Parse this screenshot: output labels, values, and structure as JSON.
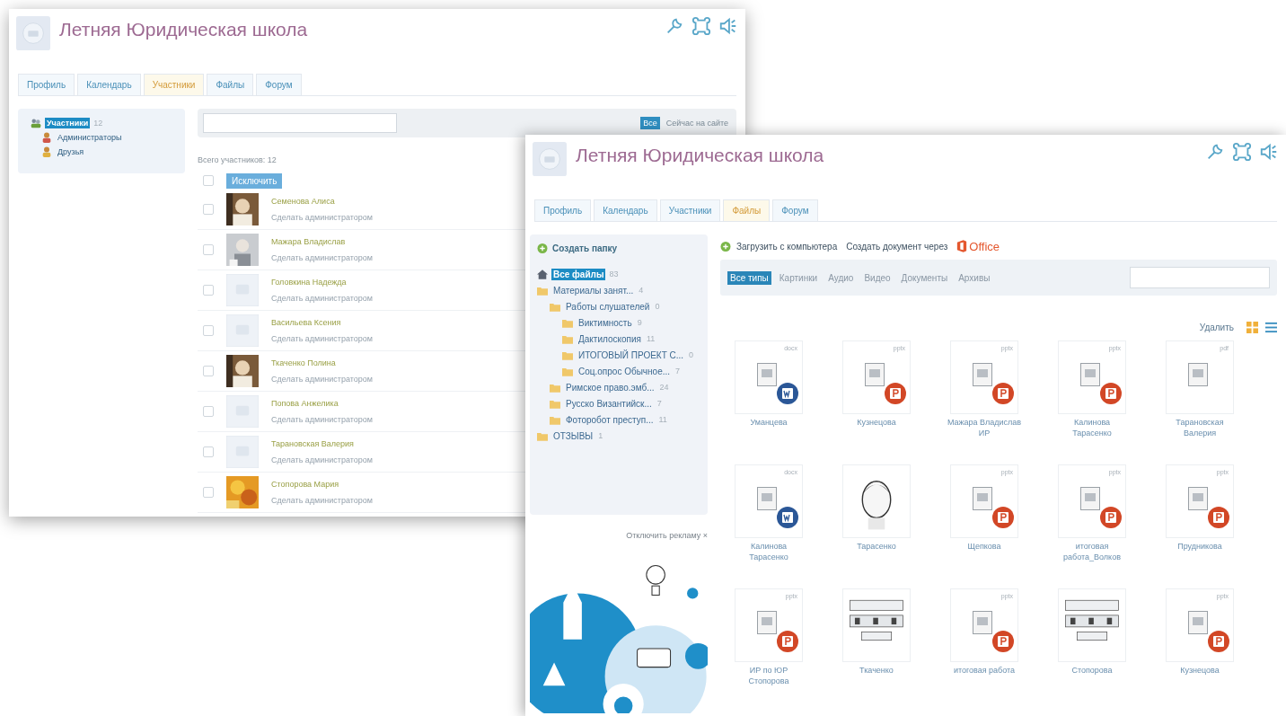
{
  "members_window": {
    "title": "Летняя Юридическая школа",
    "tabs": [
      {
        "label": "Профиль",
        "selected": false
      },
      {
        "label": "Календарь",
        "selected": false
      },
      {
        "label": "Участники",
        "selected": true
      },
      {
        "label": "Файлы",
        "selected": false
      },
      {
        "label": "Форум",
        "selected": false
      }
    ],
    "groups": [
      {
        "label": "Участники",
        "count": "12",
        "selected": true,
        "kind": "group",
        "children": [
          {
            "label": "Администраторы",
            "selected": false,
            "kind": "admin"
          },
          {
            "label": "Друзья",
            "selected": false,
            "kind": "friend"
          }
        ]
      }
    ],
    "filters": [
      {
        "label": "Все",
        "selected": true
      },
      {
        "label": "Сейчас на сайте",
        "selected": false
      }
    ],
    "total": "Всего участников: 12",
    "select_all_checked": false,
    "exclude_button": "Исключить",
    "members": [
      {
        "name": "Семенова Алиса",
        "action": "Сделать администратором",
        "checked": false
      },
      {
        "name": "Мажара Владислав",
        "action": "Сделать администратором",
        "checked": false
      },
      {
        "name": "Головкина Надежда",
        "action": "Сделать администратором",
        "kind": "placeholder",
        "checked": false
      },
      {
        "name": "Васильева Ксения",
        "action": "Сделать администратором",
        "kind": "placeholder",
        "checked": false
      },
      {
        "name": "Ткаченко Полина",
        "action": "Сделать администратором",
        "checked": false
      },
      {
        "name": "Попова Анжелика",
        "action": "Сделать администратором",
        "kind": "placeholder",
        "checked": false
      },
      {
        "name": "Тарановская Валерия",
        "action": "Сделать администратором",
        "kind": "placeholder",
        "checked": false
      },
      {
        "name": "Стопорова Мария",
        "action": "Сделать администратором",
        "checked": false
      }
    ]
  },
  "files_window": {
    "title": "Летняя Юридическая школа",
    "tabs": [
      {
        "label": "Профиль",
        "selected": false
      },
      {
        "label": "Календарь",
        "selected": false
      },
      {
        "label": "Участники",
        "selected": false
      },
      {
        "label": "Файлы",
        "selected": true
      },
      {
        "label": "Форум",
        "selected": false
      }
    ],
    "create_folder": "Создать папку",
    "tree": [
      {
        "label": "Все файлы",
        "count": "83",
        "selected": true,
        "kind": "all"
      },
      {
        "label": "Материалы занят...",
        "count": "4",
        "selected": false,
        "kind": "folder",
        "children": [
          {
            "label": "Работы слушателей",
            "count": "0",
            "selected": false,
            "kind": "folder",
            "children": [
              {
                "label": "Виктимность",
                "count": "9",
                "selected": false,
                "kind": "folder"
              },
              {
                "label": "Дактилоскопия",
                "count": "11",
                "selected": false,
                "kind": "folder"
              },
              {
                "label": "ИТОГОВЫЙ ПРОЕКТ С...",
                "count": "0",
                "selected": false,
                "kind": "folder"
              },
              {
                "label": "Соц.опрос Обычное...",
                "count": "7",
                "selected": false,
                "kind": "folder"
              }
            ]
          },
          {
            "label": "Римское право.эмб...",
            "count": "24",
            "selected": false,
            "kind": "folder"
          },
          {
            "label": "Русско Византийск...",
            "count": "7",
            "selected": false,
            "kind": "folder"
          },
          {
            "label": "Фоторобот преступ...",
            "count": "11",
            "selected": false,
            "kind": "folder"
          }
        ]
      },
      {
        "label": "ОТЗЫВЫ",
        "count": "1",
        "selected": false,
        "kind": "folder"
      }
    ],
    "upload_link": "Загрузить с компьютера",
    "create_doc_link": "Создать документ через",
    "office_label": "Office",
    "type_filters": [
      {
        "label": "Все типы",
        "selected": true
      },
      {
        "label": "Картинки",
        "selected": false
      },
      {
        "label": "Аудио",
        "selected": false
      },
      {
        "label": "Видео",
        "selected": false
      },
      {
        "label": "Документы",
        "selected": false
      },
      {
        "label": "Архивы",
        "selected": false
      }
    ],
    "delete_link": "Удалить",
    "view_modes": [
      {
        "kind": "grid",
        "selected": true
      },
      {
        "kind": "list",
        "selected": false
      }
    ],
    "files": [
      {
        "name": "Уманцева",
        "ext": "docx",
        "kind": "word"
      },
      {
        "name": "Кузнецова",
        "ext": "pptx",
        "kind": "powerpoint"
      },
      {
        "name": "Мажара Владислав ИР",
        "ext": "pptx",
        "kind": "powerpoint"
      },
      {
        "name": "Калинова Тарасенко",
        "ext": "pptx",
        "kind": "powerpoint"
      },
      {
        "name": "Тарановская Валерия",
        "ext": "pdf",
        "kind": "document"
      },
      {
        "name": "Калинова Тарасенко",
        "ext": "docx",
        "kind": "word"
      },
      {
        "name": "Тарасенко",
        "kind": "picture"
      },
      {
        "name": "Щепкова",
        "ext": "pptx",
        "kind": "powerpoint"
      },
      {
        "name": "итоговая работа_Волков",
        "ext": "pptx",
        "kind": "powerpoint"
      },
      {
        "name": "Прудникова",
        "ext": "pptx",
        "kind": "powerpoint"
      },
      {
        "name": "ИР по ЮР Стопорова",
        "ext": "pptx",
        "kind": "powerpoint"
      },
      {
        "name": "Ткаченко",
        "kind": "picture"
      },
      {
        "name": "итоговая работа",
        "ext": "pptx",
        "kind": "powerpoint"
      },
      {
        "name": "Стопорова",
        "kind": "picture"
      },
      {
        "name": "Кузнецова",
        "ext": "pptx",
        "kind": "powerpoint"
      }
    ],
    "ad": {
      "dismiss": "Отключить рекламу ×",
      "kind": "picture"
    }
  }
}
